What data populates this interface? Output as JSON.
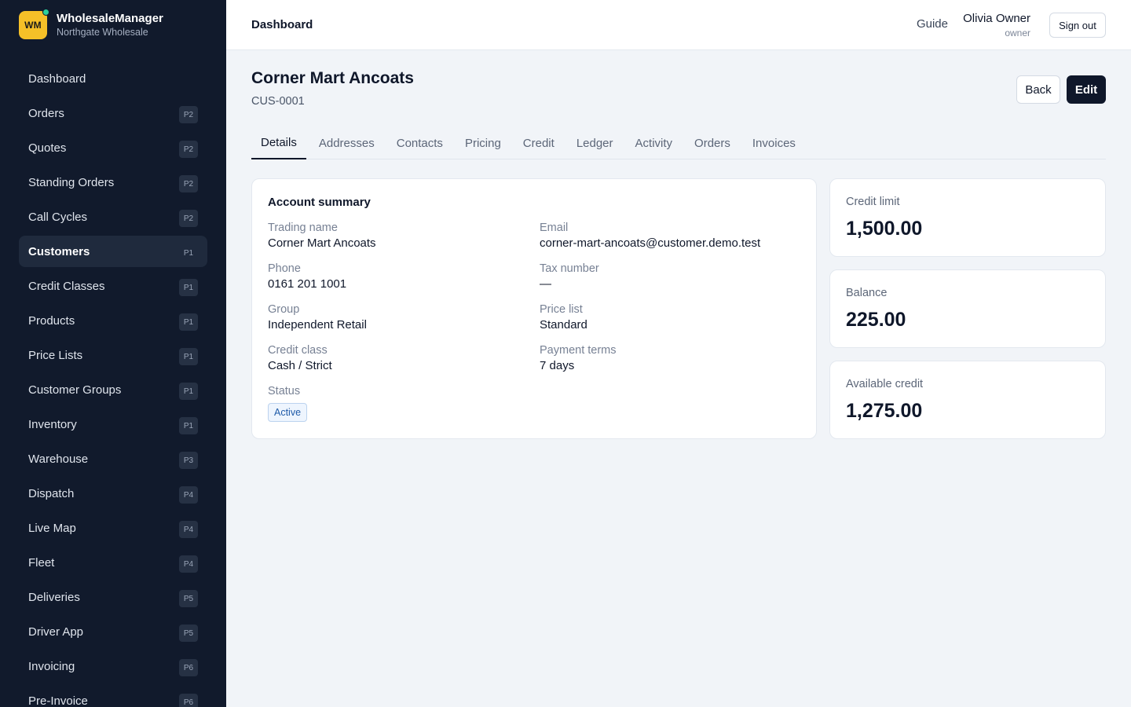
{
  "brand": {
    "logo_text": "WM",
    "name": "WholesaleManager",
    "subtitle": "Northgate Wholesale"
  },
  "sidebar": {
    "items": [
      {
        "label": "Dashboard",
        "badge": ""
      },
      {
        "label": "Orders",
        "badge": "P2"
      },
      {
        "label": "Quotes",
        "badge": "P2"
      },
      {
        "label": "Standing Orders",
        "badge": "P2"
      },
      {
        "label": "Call Cycles",
        "badge": "P2"
      },
      {
        "label": "Customers",
        "badge": "P1",
        "active": true
      },
      {
        "label": "Credit Classes",
        "badge": "P1"
      },
      {
        "label": "Products",
        "badge": "P1"
      },
      {
        "label": "Price Lists",
        "badge": "P1"
      },
      {
        "label": "Customer Groups",
        "badge": "P1"
      },
      {
        "label": "Inventory",
        "badge": "P1"
      },
      {
        "label": "Warehouse",
        "badge": "P3"
      },
      {
        "label": "Dispatch",
        "badge": "P4"
      },
      {
        "label": "Live Map",
        "badge": "P4"
      },
      {
        "label": "Fleet",
        "badge": "P4"
      },
      {
        "label": "Deliveries",
        "badge": "P5"
      },
      {
        "label": "Driver App",
        "badge": "P5"
      },
      {
        "label": "Invoicing",
        "badge": "P6"
      },
      {
        "label": "Pre-Invoice",
        "badge": "P6"
      }
    ]
  },
  "header": {
    "title": "Dashboard",
    "guide": "Guide",
    "user_name": "Olivia Owner",
    "user_role": "owner",
    "sign_out": "Sign out"
  },
  "page": {
    "title": "Corner Mart Ancoats",
    "code": "CUS-0001",
    "back_label": "Back",
    "edit_label": "Edit"
  },
  "tabs": [
    "Details",
    "Addresses",
    "Contacts",
    "Pricing",
    "Credit",
    "Ledger",
    "Activity",
    "Orders",
    "Invoices"
  ],
  "active_tab": "Details",
  "summary": {
    "title": "Account summary",
    "trading_name": {
      "label": "Trading name",
      "value": "Corner Mart Ancoats"
    },
    "email": {
      "label": "Email",
      "value": "corner-mart-ancoats@customer.demo.test"
    },
    "phone": {
      "label": "Phone",
      "value": "0161 201 1001"
    },
    "tax_number": {
      "label": "Tax number",
      "value": "—"
    },
    "group": {
      "label": "Group",
      "value": "Independent Retail"
    },
    "price_list": {
      "label": "Price list",
      "value": "Standard"
    },
    "credit_class": {
      "label": "Credit class",
      "value": "Cash / Strict"
    },
    "payment_terms": {
      "label": "Payment terms",
      "value": "7 days"
    },
    "status": {
      "label": "Status",
      "value": "Active"
    }
  },
  "stats": {
    "credit_limit": {
      "label": "Credit limit",
      "value": "1,500.00"
    },
    "balance": {
      "label": "Balance",
      "value": "225.00"
    },
    "available_credit": {
      "label": "Available credit",
      "value": "1,275.00"
    }
  },
  "colors": {
    "sidebar_bg": "#111a2c",
    "logo_bg": "#f5c028",
    "accent_dark": "#0f172a",
    "status_blue": "#1e5aa8"
  }
}
